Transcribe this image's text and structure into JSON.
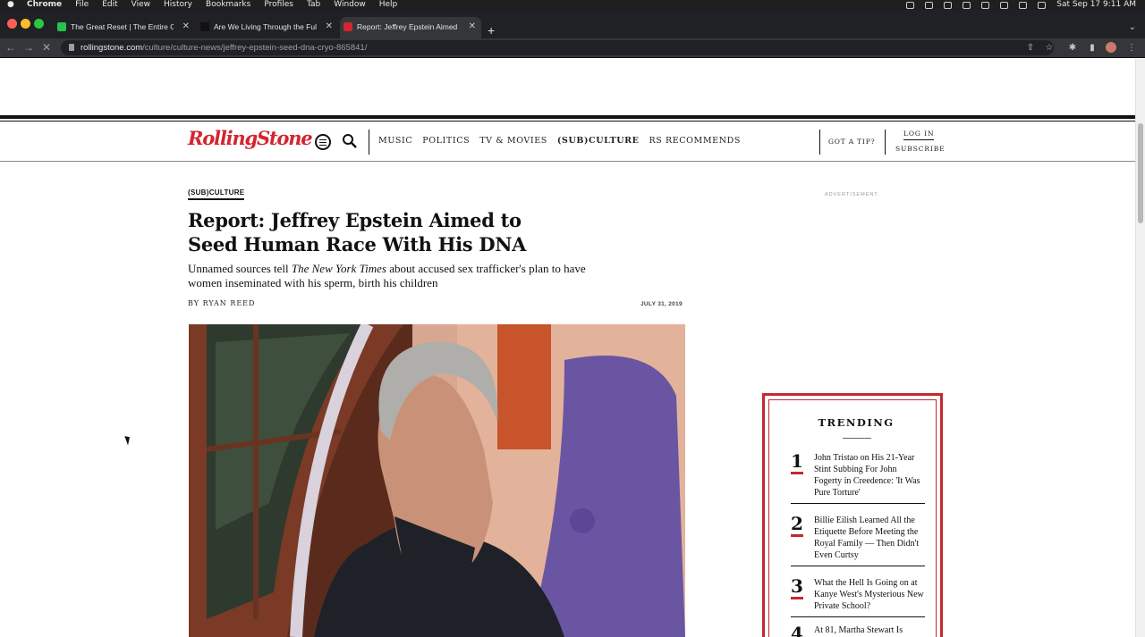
{
  "menubar": {
    "app": "Chrome",
    "items": [
      "File",
      "Edit",
      "View",
      "History",
      "Bookmarks",
      "Profiles",
      "Tab",
      "Window",
      "Help"
    ],
    "datetime": "Sat Sep 17  9:11 AM"
  },
  "tabs": [
    {
      "title": "The Great Reset | The Entire G",
      "favicon_color": "#27c24c"
    },
    {
      "title": "Are We Living Through the Full",
      "favicon_color": "#111111"
    },
    {
      "title": "Report: Jeffrey Epstein Aimed",
      "favicon_color": "#d32531",
      "active": true
    }
  ],
  "address": {
    "host": "rollingstone.com",
    "path": "/culture/culture-news/jeffrey-epstein-seed-dna-cryo-865841/"
  },
  "site": {
    "logo": "RollingStone",
    "nav": [
      "MUSIC",
      "POLITICS",
      "TV & MOVIES",
      "(SUB)CULTURE",
      "RS RECOMMENDS"
    ],
    "tip": "GOT A TIP?",
    "login": "LOG IN",
    "subscribe": "SUBSCRIBE",
    "brand_color": "#d32531"
  },
  "article": {
    "category": "(SUB)CULTURE",
    "headline": "Report: Jeffrey Epstein Aimed to Seed Human Race With His DNA",
    "dek_pre": "Unnamed sources tell ",
    "dek_em": "The New York Times",
    "dek_post": " about accused sex trafficker's plan to have women inseminated with his sperm, birth his children",
    "byline": "BY RYAN REED",
    "date": "JULY 31, 2019"
  },
  "ad": {
    "label": "ADVERTISEMENT"
  },
  "trending": {
    "title": "TRENDING",
    "items": [
      {
        "num": "1",
        "text": "John Tristao on His 21-Year Stint Subbing For John Fogerty in Creedence: 'It Was Pure Torture'"
      },
      {
        "num": "2",
        "text": "Billie Eilish Learned All the Etiquette Before Meeting the Royal Family — Then Didn't Even Curtsy"
      },
      {
        "num": "3",
        "text": "What the Hell Is Going on at Kanye West's Mysterious New Private School?"
      },
      {
        "num": "4",
        "text": "At 81, Martha Stewart Is"
      }
    ]
  }
}
